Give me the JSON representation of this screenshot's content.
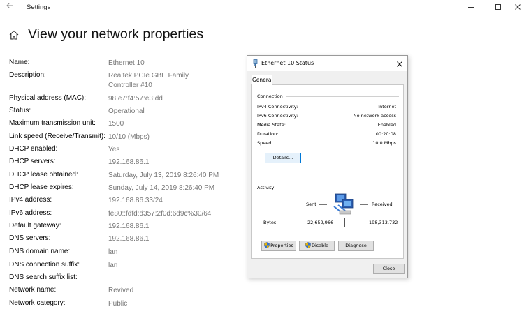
{
  "window": {
    "app_title": "Settings",
    "icons": {
      "back": "back-arrow-icon",
      "minimize": "minimize-icon",
      "maximize": "maximize-icon",
      "close": "close-icon",
      "home": "home-icon"
    }
  },
  "page": {
    "title": "View your network properties"
  },
  "properties": [
    {
      "label": "Name:",
      "value": "Ethernet 10"
    },
    {
      "label": "Description:",
      "value": "Realtek PCIe GBE Family",
      "value2": "Controller #10"
    },
    {
      "label": "Physical address (MAC):",
      "value": "98:e7:f4:57:e3:dd"
    },
    {
      "label": "Status:",
      "value": "Operational"
    },
    {
      "label": "Maximum transmission unit:",
      "value": "1500"
    },
    {
      "label": "Link speed (Receive/Transmit):",
      "value": "10/10 (Mbps)"
    },
    {
      "label": "DHCP enabled:",
      "value": "Yes"
    },
    {
      "label": "DHCP servers:",
      "value": "192.168.86.1"
    },
    {
      "label": "DHCP lease obtained:",
      "value": "Saturday, July 13, 2019 8:26:40 PM"
    },
    {
      "label": "DHCP lease expires:",
      "value": "Sunday, July 14, 2019 8:26:40 PM"
    },
    {
      "label": "IPv4 address:",
      "value": "192.168.86.33/24"
    },
    {
      "label": "IPv6 address:",
      "value": "fe80::fdfd:d357:2f0d:6d9c%30/64"
    },
    {
      "label": "Default gateway:",
      "value": "192.168.86.1"
    },
    {
      "label": "DNS servers:",
      "value": "192.168.86.1"
    },
    {
      "label": "DNS domain name:",
      "value": "lan"
    },
    {
      "label": "DNS connection suffix:",
      "value": "lan"
    },
    {
      "label": "DNS search suffix list:",
      "value": ""
    },
    {
      "label": "Network name:",
      "value": "Revived"
    },
    {
      "label": "Network category:",
      "value": "Public"
    }
  ],
  "dialog": {
    "title": "Ethernet 10 Status",
    "tab": "General",
    "connection": {
      "heading": "Connection",
      "rows": [
        {
          "label": "IPv4 Connectivity:",
          "value": "Internet"
        },
        {
          "label": "IPv6 Connectivity:",
          "value": "No network access"
        },
        {
          "label": "Media State:",
          "value": "Enabled"
        },
        {
          "label": "Duration:",
          "value": "00:20:08"
        },
        {
          "label": "Speed:",
          "value": "10.0 Mbps"
        }
      ],
      "details_button": "Details..."
    },
    "activity": {
      "heading": "Activity",
      "sent_label": "Sent",
      "received_label": "Received",
      "bytes_label": "Bytes:",
      "bytes_sent": "22,659,966",
      "bytes_received": "198,313,732",
      "icon": "network-computers-icon"
    },
    "buttons": {
      "properties": "Properties",
      "disable": "Disable",
      "diagnose": "Diagnose",
      "close": "Close"
    },
    "colors": {
      "focus_border": "#0078d7",
      "label_gray": "#767676"
    }
  }
}
